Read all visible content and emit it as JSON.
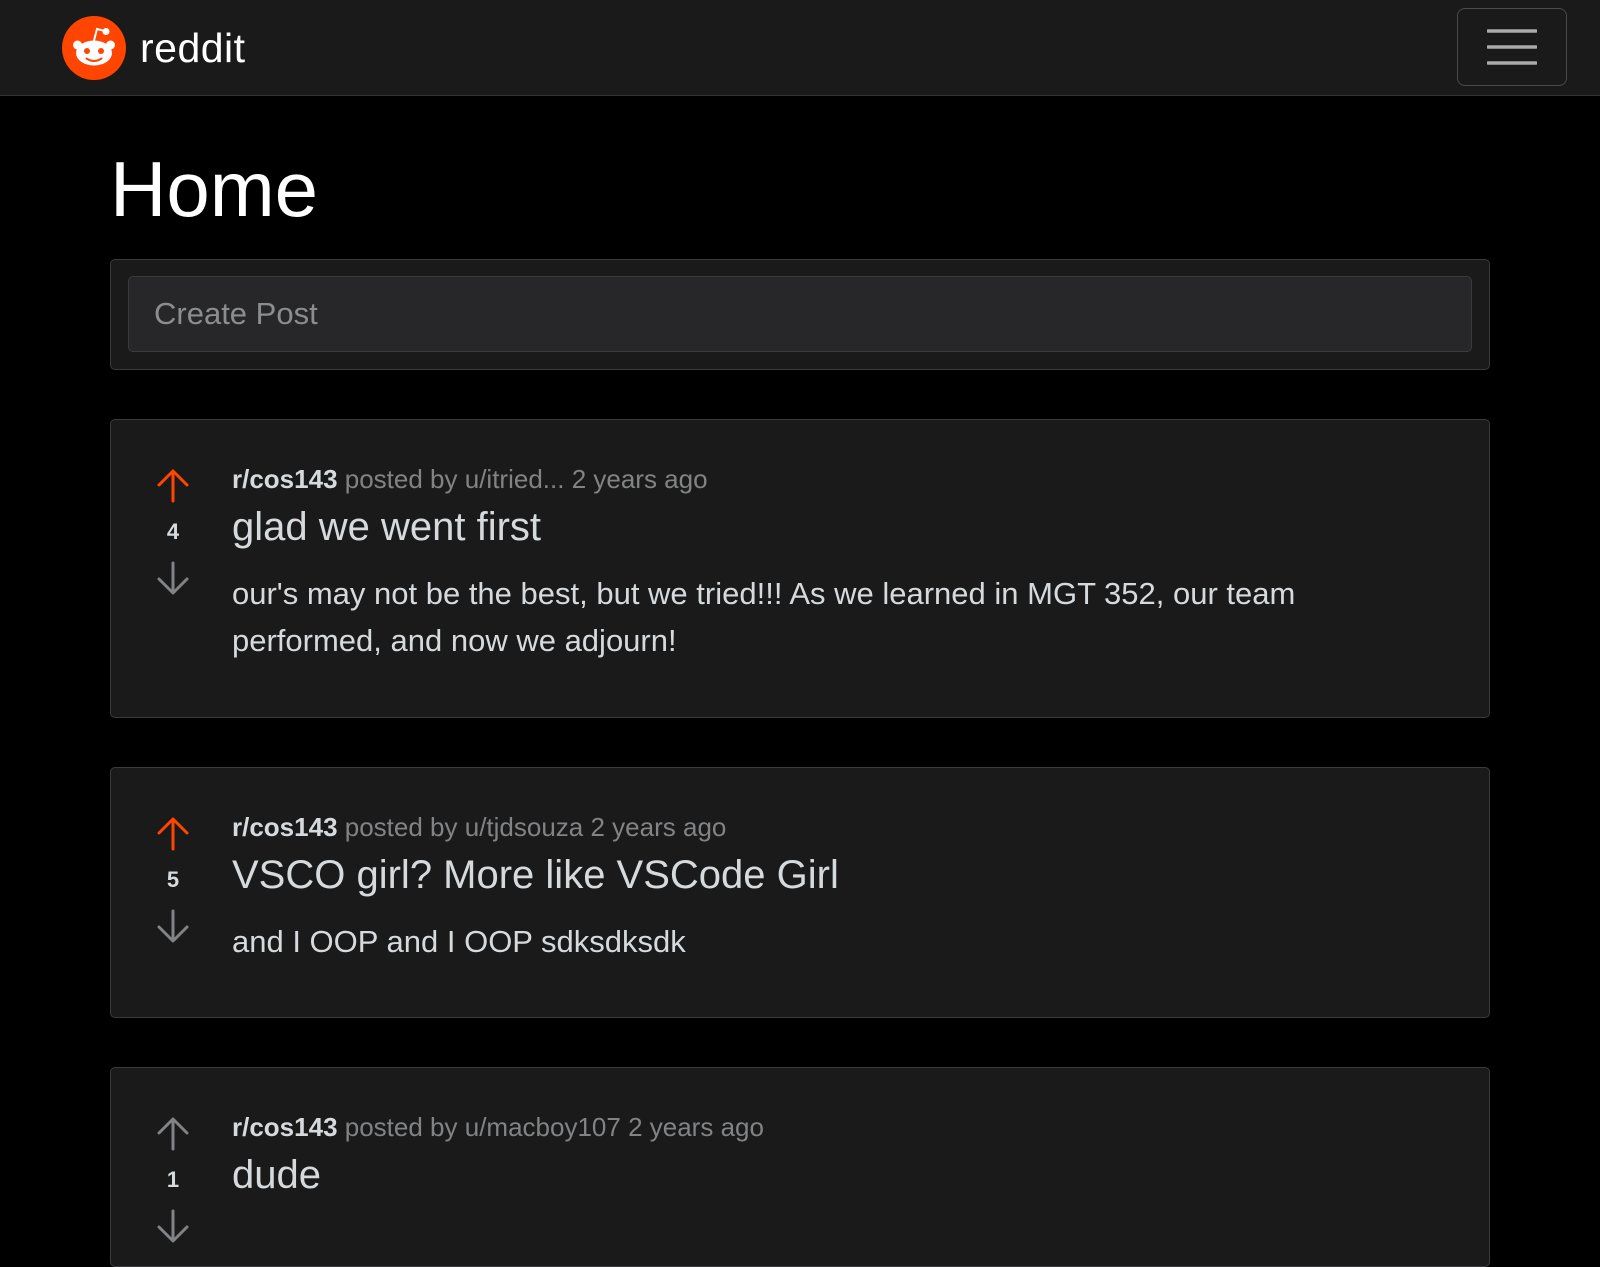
{
  "header": {
    "brand": "reddit",
    "menu_icon": "hamburger-menu-icon",
    "colors": {
      "brand_orange": "#ff4500",
      "nav_bg": "#1a1a1b"
    }
  },
  "page": {
    "title": "Home"
  },
  "create_post": {
    "placeholder": "Create Post"
  },
  "posts": [
    {
      "score": "4",
      "upvoted": true,
      "subreddit": "r/cos143",
      "posted_by": "posted by u/itried...",
      "time": "2 years ago",
      "title": "glad we went first",
      "body": "our's may not be the best, but we tried!!! As we learned in MGT 352, our team performed, and now we adjourn!"
    },
    {
      "score": "5",
      "upvoted": true,
      "subreddit": "r/cos143",
      "posted_by": "posted by u/tjdsouza",
      "time": "2 years ago",
      "title": "VSCO girl? More like VSCode Girl",
      "body": "and I OOP and I OOP sdksdksdk"
    },
    {
      "score": "1",
      "upvoted": false,
      "subreddit": "r/cos143",
      "posted_by": "posted by u/macboy107",
      "time": "2 years ago",
      "title": "dude",
      "body": ""
    }
  ]
}
